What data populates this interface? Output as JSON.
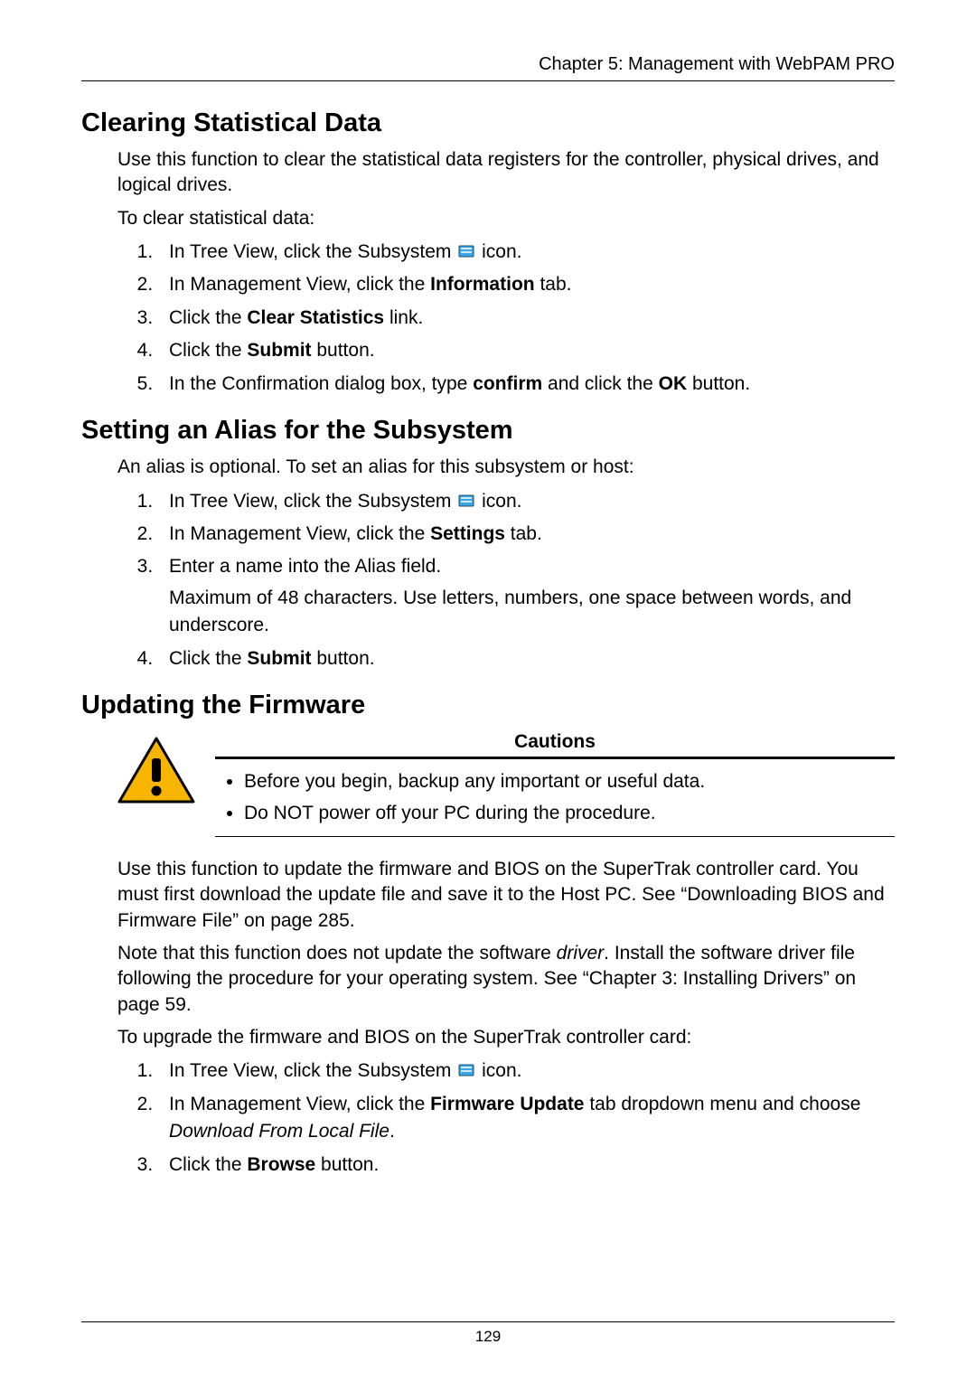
{
  "header": {
    "chapter": "Chapter 5: Management with WebPAM PRO"
  },
  "section1": {
    "title": "Clearing Statistical Data",
    "intro": "Use this function to clear the statistical data registers for the controller, physical drives, and logical drives.",
    "lead": "To clear statistical data:",
    "step1a": "In Tree View, click the Subsystem ",
    "step1b": " icon.",
    "step2a": "In Management View, click the ",
    "step2b": "Information",
    "step2c": " tab.",
    "step3a": "Click the ",
    "step3b": "Clear Statistics",
    "step3c": " link.",
    "step4a": "Click the ",
    "step4b": "Submit",
    "step4c": " button.",
    "step5a": "In the Confirmation dialog box, type ",
    "step5b": "confirm",
    "step5c": " and click the ",
    "step5d": "OK",
    "step5e": " button."
  },
  "section2": {
    "title": "Setting an Alias for the Subsystem",
    "intro": "An alias is optional. To set an alias for this subsystem or host:",
    "step1a": "In Tree View, click the Subsystem ",
    "step1b": " icon.",
    "step2a": "In Management View, click the ",
    "step2b": "Settings",
    "step2c": " tab.",
    "step3": "Enter a name into the Alias field.",
    "step3sub": "Maximum of 48 characters. Use letters, numbers, one space between words, and underscore.",
    "step4a": "Click the ",
    "step4b": "Submit",
    "step4c": " button."
  },
  "section3": {
    "title": "Updating the Firmware",
    "cautions_title": "Cautions",
    "caution1": "Before you begin, backup any important or useful data.",
    "caution2": "Do NOT power off your PC during the procedure.",
    "para1": "Use this function to update the firmware and BIOS on the SuperTrak controller card. You must first download the update file and save it to the Host PC. See “Downloading BIOS and Firmware File” on page 285.",
    "para2a": "Note that this function does not update the software ",
    "para2b": "driver",
    "para2c": ". Install the software driver file following the procedure for your operating system. See “Chapter 3: Installing Drivers” on page 59.",
    "para3": "To upgrade the firmware and BIOS on the SuperTrak controller card:",
    "step1a": "In Tree View, click the Subsystem ",
    "step1b": " icon.",
    "step2a": "In Management View, click the ",
    "step2b": "Firmware Update",
    "step2c": " tab dropdown menu and choose ",
    "step2d": "Download From Local File",
    "step2e": ".",
    "step3a": "Click the ",
    "step3b": "Browse",
    "step3c": " button."
  },
  "footer": {
    "page": "129"
  }
}
